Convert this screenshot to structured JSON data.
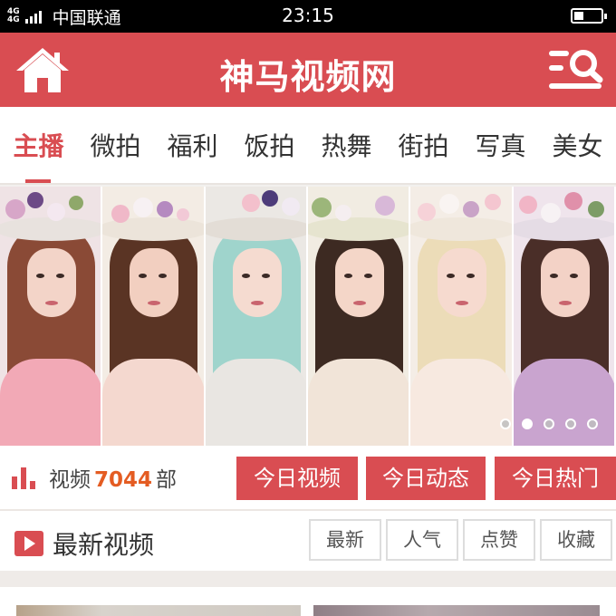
{
  "status_bar": {
    "network_a": "4G",
    "network_b": "4G",
    "carrier": "中国联通",
    "time": "23:15",
    "battery_level": 0.35
  },
  "header": {
    "title": "神马视频网",
    "home_icon": "home-icon",
    "menu_search_icon": "menu-search-icon",
    "background": "#d94d52"
  },
  "tabs": [
    {
      "label": "主播",
      "active": true
    },
    {
      "label": "微拍",
      "active": false
    },
    {
      "label": "福利",
      "active": false
    },
    {
      "label": "饭拍",
      "active": false
    },
    {
      "label": "热舞",
      "active": false
    },
    {
      "label": "街拍",
      "active": false
    },
    {
      "label": "写真",
      "active": false
    },
    {
      "label": "美女",
      "active": false
    }
  ],
  "banner": {
    "slides_total": 5,
    "active_slide": 1
  },
  "stats": {
    "prefix": "视频",
    "count": "7044",
    "suffix": "部",
    "count_color": "#e45c22"
  },
  "quick_buttons": [
    {
      "label": "今日视频"
    },
    {
      "label": "今日动态"
    },
    {
      "label": "今日热门"
    }
  ],
  "latest": {
    "title": "最新视频",
    "filters": [
      {
        "label": "最新"
      },
      {
        "label": "人气"
      },
      {
        "label": "点赞"
      },
      {
        "label": "收藏"
      }
    ]
  },
  "accent_color": "#d94d52"
}
